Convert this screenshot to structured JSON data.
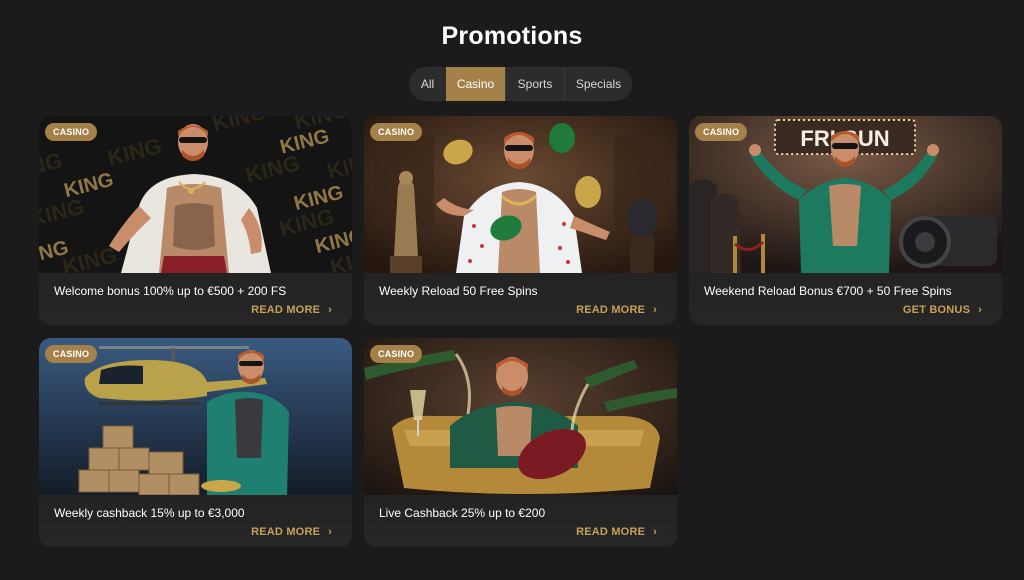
{
  "page": {
    "title": "Promotions"
  },
  "tabs": [
    {
      "label": "All",
      "active": false
    },
    {
      "label": "Casino",
      "active": true
    },
    {
      "label": "Sports",
      "active": false
    },
    {
      "label": "Specials",
      "active": false
    }
  ],
  "cards": [
    {
      "badge": "CASINO",
      "title": "Welcome bonus 100% up to €500 + 200 FS",
      "cta": "READ MORE"
    },
    {
      "badge": "CASINO",
      "title": "Weekly Reload 50 Free Spins",
      "cta": "READ MORE"
    },
    {
      "badge": "CASINO",
      "title": "Weekend Reload Bonus €700 + 50 Free Spins",
      "cta": "GET BONUS"
    },
    {
      "badge": "CASINO",
      "title": "Weekly cashback 15% up to €3,000",
      "cta": "READ MORE"
    },
    {
      "badge": "CASINO",
      "title": "Live Cashback 25% up to €200",
      "cta": "READ MORE"
    }
  ],
  "art": {
    "background_word": "KING",
    "sign_text": "FRI-SUN"
  },
  "colors": {
    "accent": "#a5814a",
    "cta": "#c8a05a",
    "background": "#1b1b1b",
    "card": "#262626"
  },
  "icons": {
    "cta_chevron": "chevron-right-icon"
  }
}
